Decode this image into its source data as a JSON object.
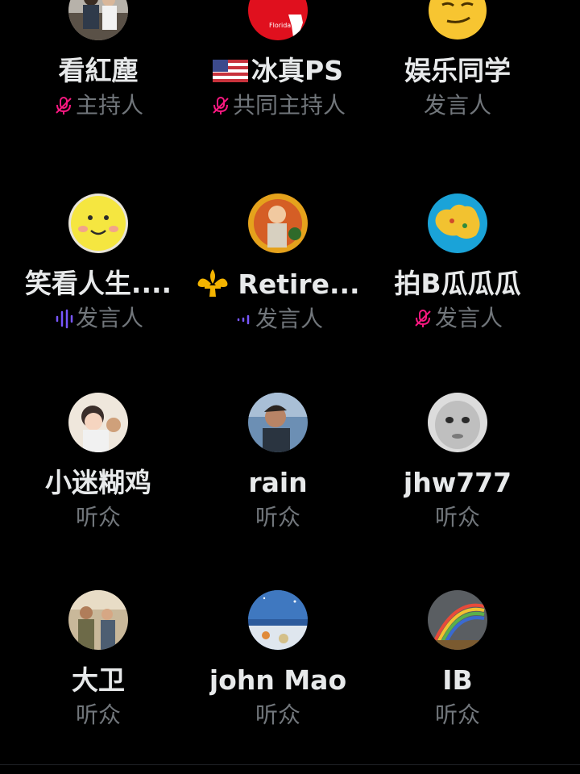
{
  "speakers_grid": {
    "items": [
      {
        "name": "看紅塵",
        "role": "主持人",
        "role_icon": "mic-muted-icon",
        "avatar": "photo-people-avatar"
      },
      {
        "name": "冰真PS",
        "role": "共同主持人",
        "role_icon": "mic-muted-icon",
        "avatar": "florida-logo-avatar",
        "name_prefix_icon": "us-flag-icon"
      },
      {
        "name": "娱乐同学",
        "role": "发言人",
        "role_icon": "",
        "avatar": "smirk-emoji-avatar"
      },
      {
        "name": "笑看人生....",
        "role": "发言人",
        "role_icon": "speaking-waveform-icon",
        "avatar": "yellow-smiley-avatar"
      },
      {
        "name": "Retire...",
        "role": "发言人",
        "role_icon": "speaking-waveform-small-icon",
        "avatar": "painting-avatar",
        "name_prefix_icon": "fleur-de-lis-icon"
      },
      {
        "name": "拍B瓜瓜瓜",
        "role": "发言人",
        "role_icon": "mic-muted-icon",
        "avatar": "australia-map-avatar"
      },
      {
        "name": "小迷糊鸡",
        "role": "听众",
        "role_icon": "",
        "avatar": "cartoon-child-avatar"
      },
      {
        "name": "rain",
        "role": "听众",
        "role_icon": "",
        "avatar": "young-man-avatar"
      },
      {
        "name": "jhw777",
        "role": "听众",
        "role_icon": "",
        "avatar": "baby-face-avatar"
      },
      {
        "name": "大卫",
        "role": "听众",
        "role_icon": "",
        "avatar": "group-photo-avatar"
      },
      {
        "name": "john Mao",
        "role": "听众",
        "role_icon": "",
        "avatar": "night-sky-avatar"
      },
      {
        "name": "IB",
        "role": "听众",
        "role_icon": "",
        "avatar": "rainbow-avatar"
      }
    ]
  },
  "colors": {
    "background": "#000000",
    "name_text": "#e7e9ea",
    "role_text": "#71767b",
    "muted_mic": "#f91880",
    "speaking_wave": "#7856ff"
  }
}
